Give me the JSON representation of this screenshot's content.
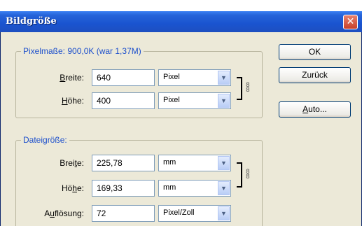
{
  "window": {
    "title": "Bildgröße",
    "close_glyph": "✕"
  },
  "pixel_group": {
    "legend": "Pixelmaße: 900,0K (war 1,37M)",
    "width_label": "Breite:",
    "width_value": "640",
    "width_unit": "Pixel",
    "height_label": "Höhe:",
    "height_value": "400",
    "height_unit": "Pixel"
  },
  "doc_group": {
    "legend": "Dateigröße:",
    "width_label": "Breite:",
    "width_value": "225,78",
    "width_unit": "mm",
    "height_label": "Höhe:",
    "height_value": "169,33",
    "height_unit": "mm",
    "resolution_label": "Auflösung:",
    "resolution_value": "72",
    "resolution_unit": "Pixel/Zoll"
  },
  "buttons": {
    "ok": "OK",
    "reset": "Zurück",
    "auto": "Auto..."
  },
  "icons": {
    "chain": "chain-link-icon",
    "dropdown": "chevron-down-icon"
  }
}
